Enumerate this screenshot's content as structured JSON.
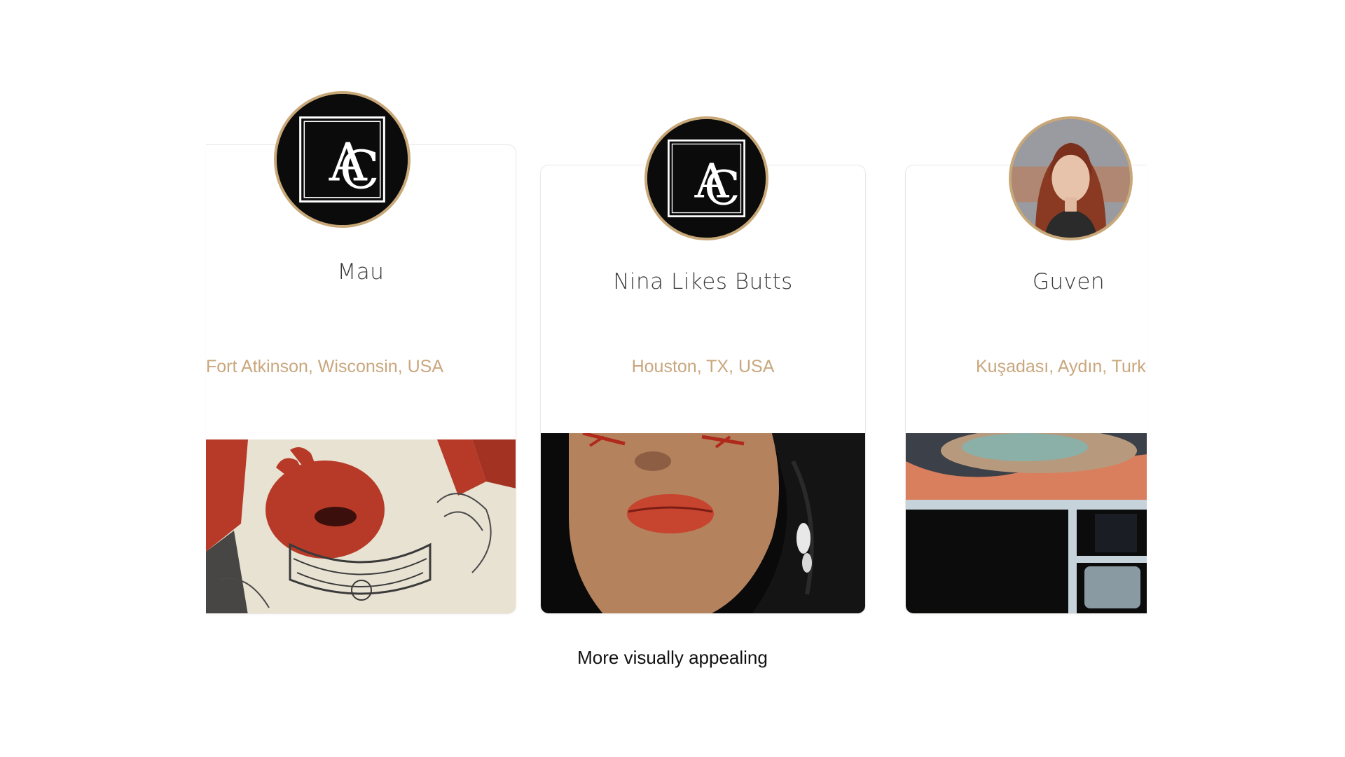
{
  "artists": [
    {
      "name": "Mau",
      "location": "Fort Atkinson, Wisconsin, USA",
      "avatar": "ac-monogram-logo",
      "artwork": "red-hand-etching-artwork"
    },
    {
      "name": "Nina Likes Butts",
      "location": "Houston, TX, USA",
      "avatar": "ac-monogram-logo",
      "artwork": "woman-portrait-red-lips-artwork"
    },
    {
      "name": "Guven",
      "location": "Kuşadası, Aydın, Turke",
      "avatar": "red-haired-woman-portrait",
      "artwork": "abstract-landscape-window-artwork"
    }
  ],
  "caption": "More visually appealing",
  "colors": {
    "avatar_border": "#c8a878",
    "location_text": "#c9a77e",
    "name_text": "#3a3a3a",
    "card_border": "#ece9e4"
  }
}
